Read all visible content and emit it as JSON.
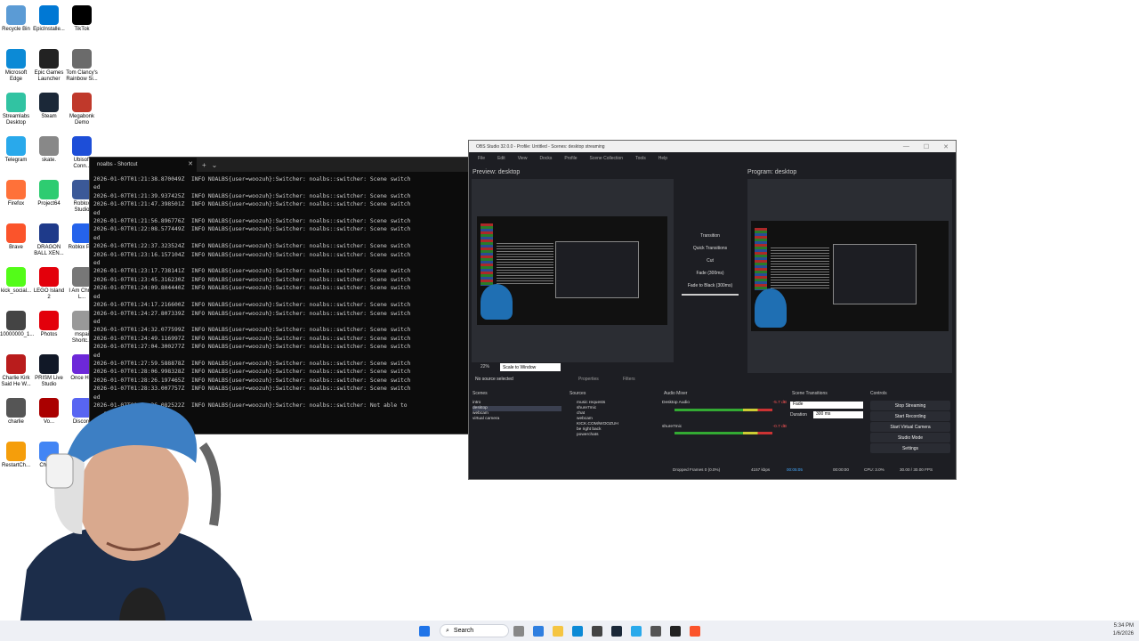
{
  "desktop": {
    "icons": [
      {
        "label": "Recycle Bin",
        "color": "#5b9bd5"
      },
      {
        "label": "EpicInstalle...",
        "color": "#0078d4"
      },
      {
        "label": "TikTok",
        "color": "#000000"
      },
      {
        "label": "Microsoft Edge",
        "color": "#0c8ad6"
      },
      {
        "label": "Epic Games Launcher",
        "color": "#222222"
      },
      {
        "label": "Tom Clancy's Rainbow Si...",
        "color": "#6b6b6b"
      },
      {
        "label": "Streamlabs Desktop",
        "color": "#31c3a2"
      },
      {
        "label": "Steam",
        "color": "#1b2838"
      },
      {
        "label": "Megabonk Demo",
        "color": "#c0392b"
      },
      {
        "label": "Telegram",
        "color": "#29a9eb"
      },
      {
        "label": "skate.",
        "color": "#888888"
      },
      {
        "label": "Ubisoft Conn...",
        "color": "#1d4ed8"
      },
      {
        "label": "Firefox",
        "color": "#ff7139"
      },
      {
        "label": "Project64",
        "color": "#2ecc71"
      },
      {
        "label": "Roblox Studio",
        "color": "#3b5998"
      },
      {
        "label": "Brave",
        "color": "#fb542b"
      },
      {
        "label": "DRAGON BALL XEN...",
        "color": "#1e3a8a"
      },
      {
        "label": "Roblox Pl...",
        "color": "#2563eb"
      },
      {
        "label": "kick_social...",
        "color": "#53fc18"
      },
      {
        "label": "LEGO Island 2",
        "color": "#e3000b"
      },
      {
        "label": "I Am Christ L...",
        "color": "#777777"
      },
      {
        "label": "10000000_1...",
        "color": "#444444"
      },
      {
        "label": "Photos",
        "color": "#e3000b"
      },
      {
        "label": "mspai Shortc...",
        "color": "#999999"
      },
      {
        "label": "Charlie Kirk Said He W...",
        "color": "#b91c1c"
      },
      {
        "label": "PRISM Live Studio",
        "color": "#111827"
      },
      {
        "label": "Once H...",
        "color": "#6d28d9"
      },
      {
        "label": "charlie",
        "color": "#555555"
      },
      {
        "label": "Vo...",
        "color": "#aa0000"
      },
      {
        "label": "Discord",
        "color": "#5865f2"
      },
      {
        "label": "RestartCh...",
        "color": "#f59e0b"
      },
      {
        "label": "Chrome",
        "color": "#4285f4"
      }
    ]
  },
  "terminal": {
    "tab_title": "noalbs - Shortcut",
    "lines": [
      "2026-01-07T01:21:38.870049Z  INFO NOALBS{user=woozuh}:Switcher: noalbs::switcher: Scene switch",
      "ed",
      "2026-01-07T01:21:39.937425Z  INFO NOALBS{user=woozuh}:Switcher: noalbs::switcher: Scene switch",
      "2026-01-07T01:21:47.398501Z  INFO NOALBS{user=woozuh}:Switcher: noalbs::switcher: Scene switch",
      "ed",
      "2026-01-07T01:21:56.896776Z  INFO NOALBS{user=woozuh}:Switcher: noalbs::switcher: Scene switch",
      "2026-01-07T01:22:08.577449Z  INFO NOALBS{user=woozuh}:Switcher: noalbs::switcher: Scene switch",
      "ed",
      "2026-01-07T01:22:37.323524Z  INFO NOALBS{user=woozuh}:Switcher: noalbs::switcher: Scene switch",
      "2026-01-07T01:23:16.157104Z  INFO NOALBS{user=woozuh}:Switcher: noalbs::switcher: Scene switch",
      "ed",
      "2026-01-07T01:23:17.738141Z  INFO NOALBS{user=woozuh}:Switcher: noalbs::switcher: Scene switch",
      "2026-01-07T01:23:45.316230Z  INFO NOALBS{user=woozuh}:Switcher: noalbs::switcher: Scene switch",
      "2026-01-07T01:24:09.804440Z  INFO NOALBS{user=woozuh}:Switcher: noalbs::switcher: Scene switch",
      "ed",
      "2026-01-07T01:24:17.216600Z  INFO NOALBS{user=woozuh}:Switcher: noalbs::switcher: Scene switch",
      "2026-01-07T01:24:27.807339Z  INFO NOALBS{user=woozuh}:Switcher: noalbs::switcher: Scene switch",
      "ed",
      "2026-01-07T01:24:32.077599Z  INFO NOALBS{user=woozuh}:Switcher: noalbs::switcher: Scene switch",
      "2026-01-07T01:24:49.116997Z  INFO NOALBS{user=woozuh}:Switcher: noalbs::switcher: Scene switch",
      "2026-01-07T01:27:04.300277Z  INFO NOALBS{user=woozuh}:Switcher: noalbs::switcher: Scene switch",
      "ed",
      "2026-01-07T01:27:59.588878Z  INFO NOALBS{user=woozuh}:Switcher: noalbs::switcher: Scene switch",
      "2026-01-07T01:28:06.998328Z  INFO NOALBS{user=woozuh}:Switcher: noalbs::switcher: Scene switch",
      "2026-01-07T01:28:26.197465Z  INFO NOALBS{user=woozuh}:Switcher: noalbs::switcher: Scene switch",
      "2026-01-07T01:28:33.007757Z  INFO NOALBS{user=woozuh}:Switcher: noalbs::switcher: Scene switch",
      "ed",
      "2026-01-07T01:28:36.082522Z  INFO NOALBS{user=woozuh}:Switcher: noalbs::switcher: Not able to",
      "   scene"
    ]
  },
  "obs": {
    "title": "OBS Studio 32.0.0 - Profile: Untitled - Scenes: desktop streaming",
    "menu": [
      "File",
      "Edit",
      "View",
      "Docks",
      "Profile",
      "Scene Collection",
      "Tools",
      "Help"
    ],
    "preview_label": "Preview: desktop",
    "program_label": "Program: desktop",
    "transition": {
      "label": "Transition",
      "quick": "Quick Transitions",
      "cut": "Cut",
      "fade": "Fade (300ms)",
      "fade_black": "Fade to Black (300ms)"
    },
    "zoom": "22%",
    "scale_mode": "Scale to Window",
    "no_source": "No source selected",
    "properties": "Properties",
    "filters": "Filters",
    "docks": {
      "scenes_title": "Scenes",
      "scenes": [
        "intro",
        "desktop",
        "webcam",
        "virtual camera"
      ],
      "sources_title": "Sources",
      "sources": [
        "music requests",
        "shure7mic",
        "chat",
        "webcam",
        "KICK.COM/WOOZUH",
        "be right back",
        "powerchats"
      ],
      "mixer_title": "Audio Mixer",
      "mixer": [
        {
          "name": "Desktop Audio",
          "db": "-5.7 dB"
        },
        {
          "name": "shure7mic",
          "db": "-0.7 dB"
        }
      ],
      "transitions_title": "Scene Transitions",
      "transition_value": "Fade",
      "duration_label": "Duration",
      "duration_value": "300 ms",
      "controls_title": "Controls",
      "controls": [
        "Stop Streaming",
        "Start Recording",
        "Start Virtual Camera",
        "Studio Mode",
        "Settings"
      ]
    },
    "status": {
      "dropped": "Dropped Frames 0 (0.0%)",
      "bitrate": "4157 kbps",
      "stream_time": "00:05:05",
      "rec_time": "00:00:00",
      "cpu": "CPU: 3.0%",
      "fps": "30.00 / 30.00 FPS"
    }
  },
  "taskbar": {
    "search": "Search",
    "time": "5:34 PM",
    "date": "1/6/2026"
  }
}
